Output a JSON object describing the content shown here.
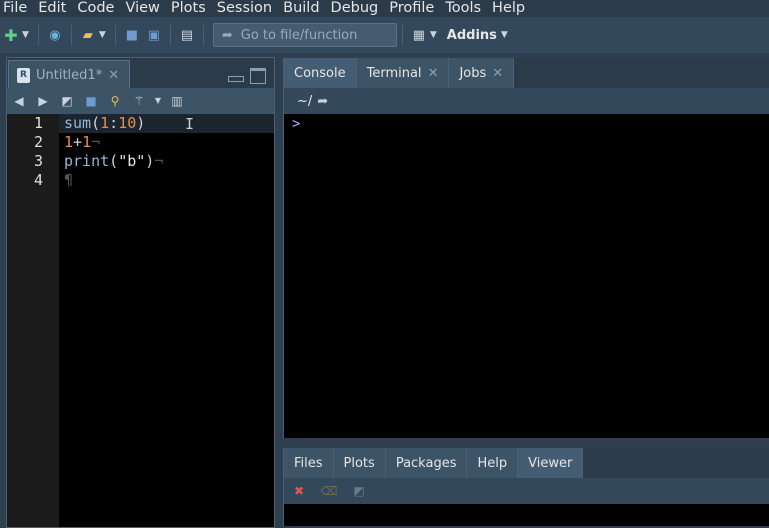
{
  "menu": [
    "File",
    "Edit",
    "Code",
    "View",
    "Plots",
    "Session",
    "Build",
    "Debug",
    "Profile",
    "Tools",
    "Help"
  ],
  "toolbar": {
    "goto_placeholder": "Go to file/function",
    "addins_label": "Addins"
  },
  "editor": {
    "tab_label": "Untitled1*",
    "lines": [
      {
        "number": "1"
      },
      {
        "number": "2"
      },
      {
        "number": "3"
      },
      {
        "number": "4"
      }
    ]
  },
  "console": {
    "tabs": [
      {
        "label": "Console"
      },
      {
        "label": "Terminal"
      },
      {
        "label": "Jobs"
      }
    ],
    "path": "~/",
    "prompt": ">"
  },
  "viewer": {
    "tabs": [
      {
        "label": "Files"
      },
      {
        "label": "Plots"
      },
      {
        "label": "Packages"
      },
      {
        "label": "Help"
      },
      {
        "label": "Viewer"
      }
    ]
  },
  "code_tokens": {
    "l1_fn": "sum",
    "l1_open": "(",
    "l1_a": "1",
    "l1_colon": ":",
    "l1_b": "10",
    "l1_close": ")",
    "l2_a": "1",
    "l2_op": "+",
    "l2_b": "1",
    "l2_eol": "¬",
    "l3_fn": "print",
    "l3_open": "(",
    "l3_str": "\"b\"",
    "l3_close": ")",
    "l3_eol": "¬",
    "l4_eol": "¶"
  }
}
